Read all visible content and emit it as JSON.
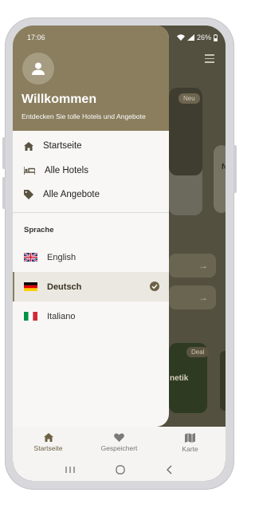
{
  "status_bar": {
    "time": "17:06",
    "battery": "26%"
  },
  "drawer": {
    "title": "Willkommen",
    "subtitle": "Entdecken Sie tolle Hotels und Angebote",
    "menu": [
      {
        "label": "Startseite",
        "icon": "home-icon"
      },
      {
        "label": "Alle Hotels",
        "icon": "bed-icon"
      },
      {
        "label": "Alle Angebote",
        "icon": "tag-icon"
      }
    ],
    "language_section_title": "Sprache",
    "languages": [
      {
        "label": "English",
        "flag": "uk-flag-icon",
        "selected": false
      },
      {
        "label": "Deutsch",
        "flag": "german-flag-icon",
        "selected": true
      },
      {
        "label": "Italiano",
        "flag": "italian-flag-icon",
        "selected": false
      }
    ]
  },
  "background": {
    "badge_new": "Neu",
    "badge_deal": "Deal",
    "partial_card_text": "netik",
    "partial_letter": "N"
  },
  "bottom_nav": [
    {
      "label": "Startseite",
      "icon": "home-icon",
      "active": true
    },
    {
      "label": "Gespeichert",
      "icon": "heart-icon",
      "active": false
    },
    {
      "label": "Karte",
      "icon": "map-icon",
      "active": false
    }
  ],
  "colors": {
    "accent": "#8a7e5e",
    "drawer_bg": "#f8f7f5",
    "selected_bg": "#ebe8e2"
  }
}
